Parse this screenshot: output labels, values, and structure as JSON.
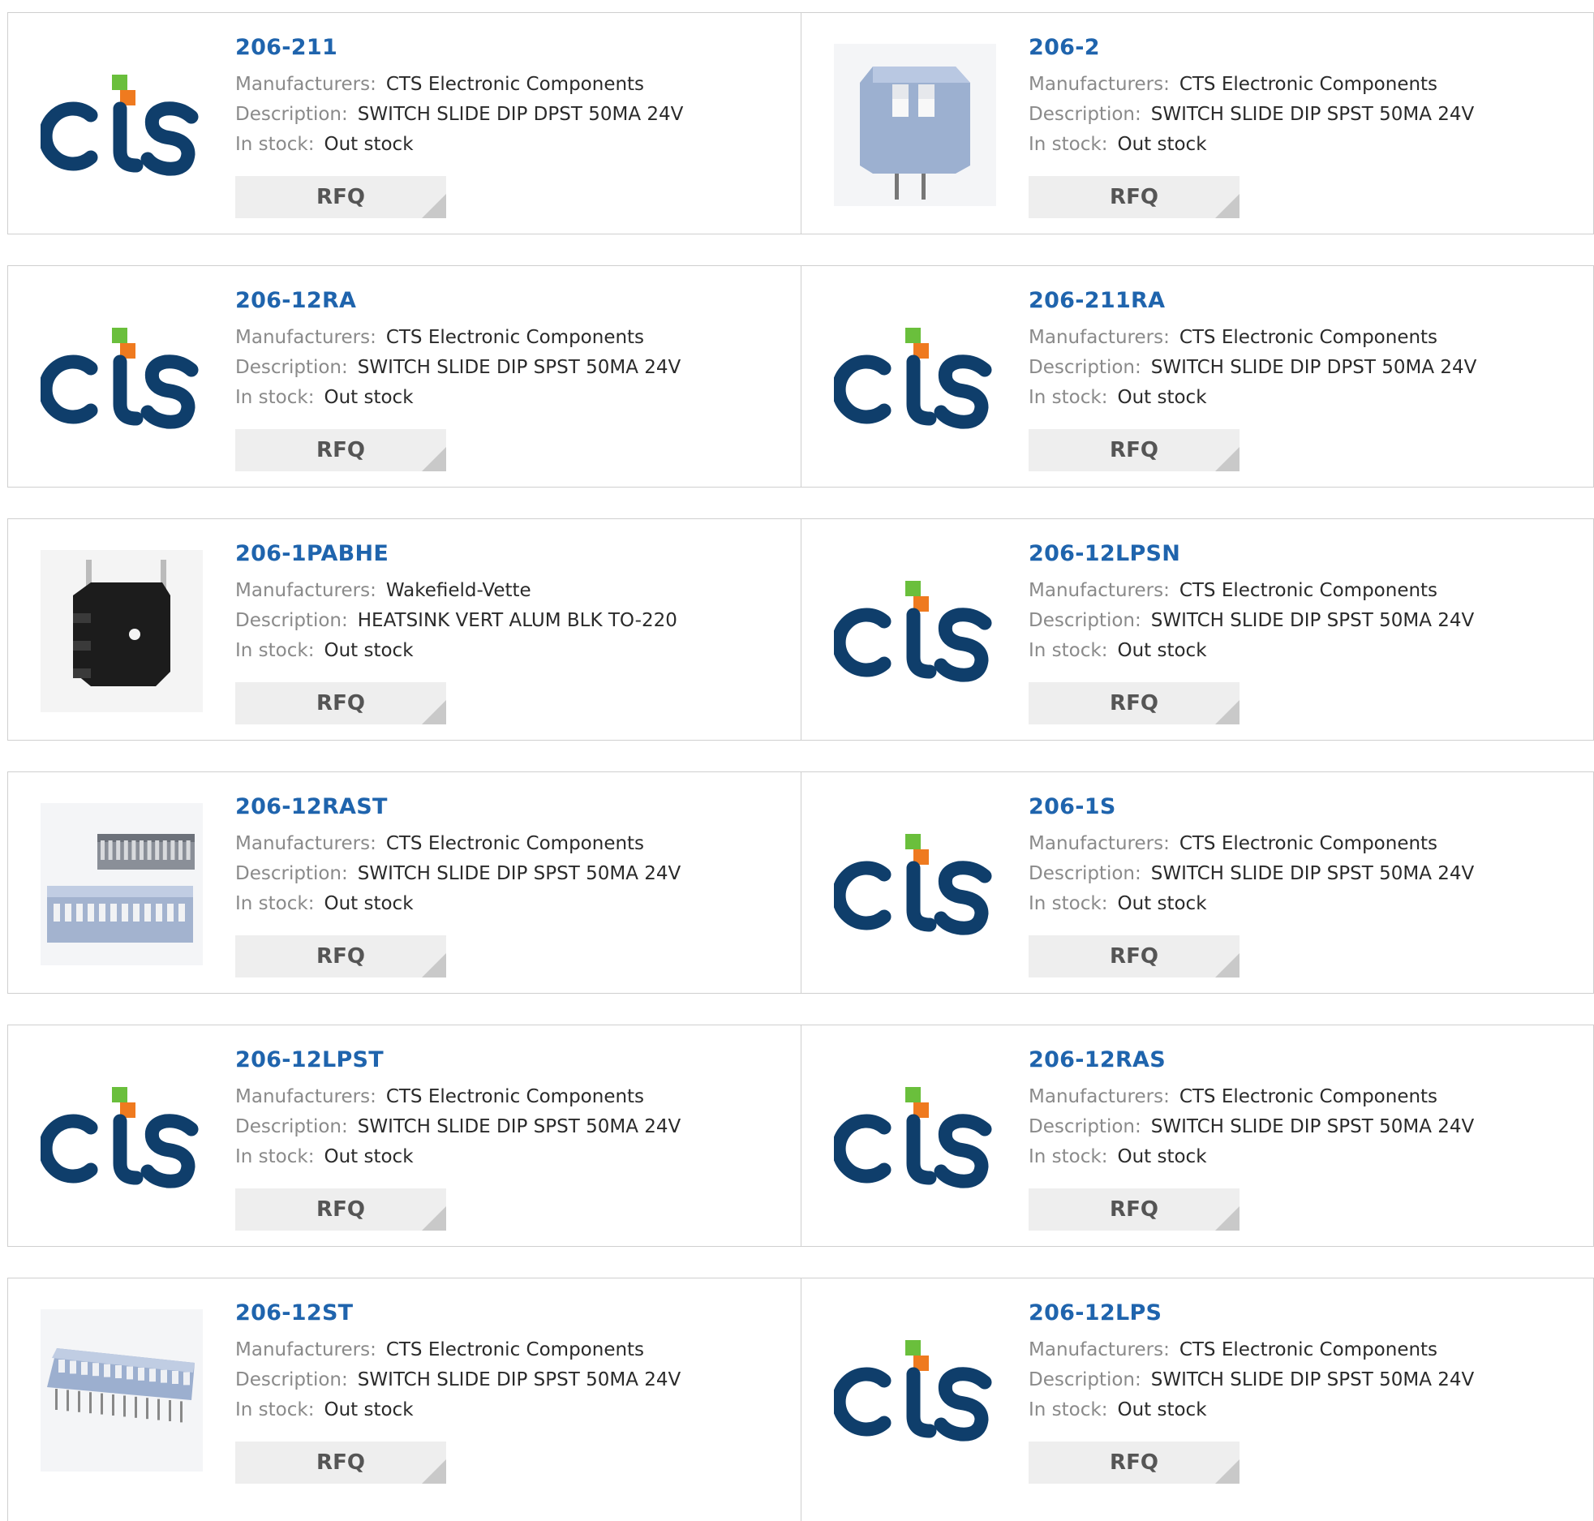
{
  "labels": {
    "manufacturer": "Manufacturers:",
    "description": "Description:",
    "stock": "In stock:",
    "rfq": "RFQ"
  },
  "logo_text": "CTS",
  "colors": {
    "part_link": "#1f64ad",
    "cts_blue": "#0f3e6b",
    "cts_green": "#6abf3c",
    "cts_orange": "#ef7a1f",
    "button_bg": "#eeeeee"
  },
  "products": [
    {
      "part": "206-211",
      "manufacturer": "CTS Electronic Components",
      "description": "SWITCH SLIDE DIP DPST 50MA 24V",
      "stock": "Out stock",
      "image": "cts-logo"
    },
    {
      "part": "206-2",
      "manufacturer": "CTS Electronic Components",
      "description": "SWITCH SLIDE DIP SPST 50MA 24V",
      "stock": "Out stock",
      "image": "dip-switch-2pos"
    },
    {
      "part": "206-12RA",
      "manufacturer": "CTS Electronic Components",
      "description": "SWITCH SLIDE DIP SPST 50MA 24V",
      "stock": "Out stock",
      "image": "cts-logo"
    },
    {
      "part": "206-211RA",
      "manufacturer": "CTS Electronic Components",
      "description": "SWITCH SLIDE DIP DPST 50MA 24V",
      "stock": "Out stock",
      "image": "cts-logo"
    },
    {
      "part": "206-1PABHE",
      "manufacturer": "Wakefield-Vette",
      "description": "HEATSINK VERT ALUM BLK TO-220",
      "stock": "Out stock",
      "image": "heatsink"
    },
    {
      "part": "206-12LPSN",
      "manufacturer": "CTS Electronic Components",
      "description": "SWITCH SLIDE DIP SPST 50MA 24V",
      "stock": "Out stock",
      "image": "cts-logo"
    },
    {
      "part": "206-12RAST",
      "manufacturer": "CTS Electronic Components",
      "description": "SWITCH SLIDE DIP SPST 50MA 24V",
      "stock": "Out stock",
      "image": "dip-switch-12pos-pair"
    },
    {
      "part": "206-1S",
      "manufacturer": "CTS Electronic Components",
      "description": "SWITCH SLIDE DIP SPST 50MA 24V",
      "stock": "Out stock",
      "image": "cts-logo"
    },
    {
      "part": "206-12LPST",
      "manufacturer": "CTS Electronic Components",
      "description": "SWITCH SLIDE DIP SPST 50MA 24V",
      "stock": "Out stock",
      "image": "cts-logo"
    },
    {
      "part": "206-12RAS",
      "manufacturer": "CTS Electronic Components",
      "description": "SWITCH SLIDE DIP SPST 50MA 24V",
      "stock": "Out stock",
      "image": "cts-logo"
    },
    {
      "part": "206-12ST",
      "manufacturer": "CTS Electronic Components",
      "description": "SWITCH SLIDE DIP SPST 50MA 24V",
      "stock": "Out stock",
      "image": "dip-switch-12pos"
    },
    {
      "part": "206-12LPS",
      "manufacturer": "CTS Electronic Components",
      "description": "SWITCH SLIDE DIP SPST 50MA 24V",
      "stock": "Out stock",
      "image": "cts-logo"
    }
  ]
}
